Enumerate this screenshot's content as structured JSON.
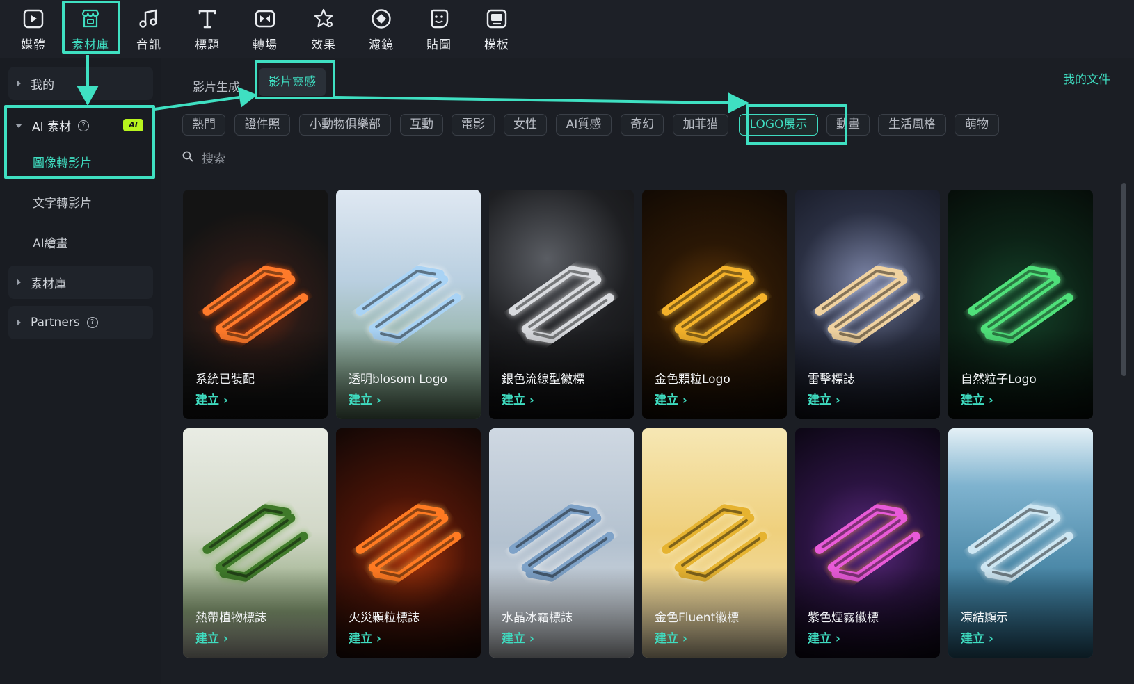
{
  "toolbar": {
    "items": [
      {
        "label": "媒體",
        "icon": "media-icon"
      },
      {
        "label": "素材庫",
        "icon": "store-icon"
      },
      {
        "label": "音訊",
        "icon": "music-note-icon"
      },
      {
        "label": "標題",
        "icon": "text-t-icon"
      },
      {
        "label": "轉場",
        "icon": "transition-icon"
      },
      {
        "label": "效果",
        "icon": "star-effect-icon"
      },
      {
        "label": "濾鏡",
        "icon": "filter-icon"
      },
      {
        "label": "貼圖",
        "icon": "sticker-icon"
      },
      {
        "label": "模板",
        "icon": "template-icon"
      }
    ],
    "active_index": 1
  },
  "sidebar": {
    "my": "我的",
    "ai_assets": "AI 素材",
    "ai_badge": "AI",
    "ai_children": [
      "圖像轉影片",
      "文字轉影片",
      "AI繪畫"
    ],
    "library": "素材庫",
    "partners": "Partners"
  },
  "subtabs": [
    "影片生成",
    "影片靈感"
  ],
  "my_documents": "我的文件",
  "chips": [
    "熱門",
    "證件照",
    "小動物俱樂部",
    "互動",
    "電影",
    "女性",
    "AI質感",
    "奇幻",
    "加菲猫",
    "LOGO展示",
    "動畫",
    "生活風格",
    "萌物"
  ],
  "active_chip": "LOGO展示",
  "search": {
    "placeholder": "搜索"
  },
  "cards": [
    {
      "title": "系統已裝配",
      "action": "建立 ›",
      "theme": "orange-tech"
    },
    {
      "title": "透明blosom Logo",
      "action": "建立 ›",
      "theme": "glass-blossom"
    },
    {
      "title": "銀色流線型徽標",
      "action": "建立 ›",
      "theme": "silver"
    },
    {
      "title": "金色顆粒Logo",
      "action": "建立 ›",
      "theme": "gold-particle"
    },
    {
      "title": "雷擊標誌",
      "action": "建立 ›",
      "theme": "lightning"
    },
    {
      "title": "自然粒子Logo",
      "action": "建立 ›",
      "theme": "green-particle"
    },
    {
      "title": "熱帶植物標誌",
      "action": "建立 ›",
      "theme": "tropical"
    },
    {
      "title": "火災顆粒標誌",
      "action": "建立 ›",
      "theme": "fire"
    },
    {
      "title": "水晶冰霜標誌",
      "action": "建立 ›",
      "theme": "ice"
    },
    {
      "title": "金色Fluent徽標",
      "action": "建立 ›",
      "theme": "gold-fluent"
    },
    {
      "title": "紫色煙霧徽標",
      "action": "建立 ›",
      "theme": "purple-smoke"
    },
    {
      "title": "凍結顯示",
      "action": "建立 ›",
      "theme": "frozen"
    }
  ],
  "colors": {
    "accent": "#3fdcc0",
    "highlight": "#3fe0c2",
    "ai_badge": "#b8f51e"
  }
}
